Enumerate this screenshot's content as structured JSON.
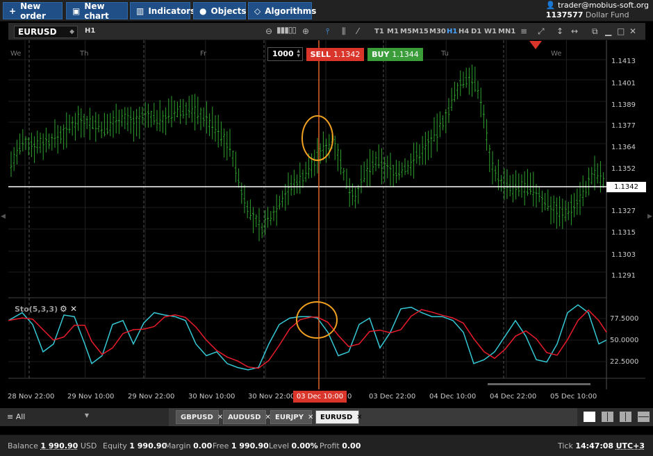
{
  "toolbar": {
    "new_order": "New order",
    "new_chart": "New chart",
    "indicators": "Indicators",
    "objects": "Objects",
    "algorithms": "Algorithms"
  },
  "account": {
    "user": "trader@mobius-soft.org",
    "number": "1137577",
    "fund": "Dollar Fund"
  },
  "chart_header": {
    "symbol": "EURUSD",
    "timeframe": "H1",
    "timeframes": [
      "T1",
      "M1",
      "M5",
      "M15",
      "M30",
      "H1",
      "H4",
      "D1",
      "W1",
      "MN1"
    ],
    "active_timeframe": "H1"
  },
  "order_panel": {
    "quantity": "1000",
    "sell_label": "SELL",
    "sell_price": "1.1342",
    "buy_label": "BUY",
    "buy_price": "1.1344"
  },
  "price_axis": [
    "1.1413",
    "1.1401",
    "1.1389",
    "1.1377",
    "1.1364",
    "1.1352",
    "1.1327",
    "1.1315",
    "1.1303",
    "1.1291"
  ],
  "current_price": "1.1342",
  "day_labels": [
    "We",
    "Th",
    "Fr",
    "Tu",
    "We"
  ],
  "stochastic": {
    "label": "Sto(5,3,3)",
    "levels": [
      "77.5000",
      "50.0000",
      "22.5000"
    ]
  },
  "time_axis": [
    "28 Nov 22:00",
    "29 Nov 10:00",
    "29 Nov 22:00",
    "30 Nov 10:00",
    "30 Nov 22:00",
    "0",
    "03 Dec 22:00",
    "04 Dec 10:00",
    "04 Dec 22:00",
    "05 Dec 10:00"
  ],
  "crosshair_time": "03 Dec 10:00",
  "tabs": {
    "filter": "All",
    "items": [
      "GBPUSD",
      "AUDUSD",
      "EURJPY",
      "EURUSD"
    ],
    "active": "EURUSD"
  },
  "status": {
    "balance_label": "Balance",
    "balance": "1 990.90",
    "currency": "USD",
    "equity_label": "Equity",
    "equity": "1 990.90",
    "margin_label": "Margin",
    "margin": "0.00",
    "free_label": "Free",
    "free": "1 990.90",
    "level_label": "Level",
    "level": "0.00%",
    "profit_label": "Profit",
    "profit": "0.00",
    "tick_label": "Tick",
    "tick_time": "14:47:08",
    "timezone": "UTC+3"
  },
  "colors": {
    "bar": "#2ea22e",
    "stoch_k": "#35c9d6",
    "stoch_d": "#e81c2a",
    "crosshair": "#e0622a",
    "highlight": "#f0a020"
  }
}
